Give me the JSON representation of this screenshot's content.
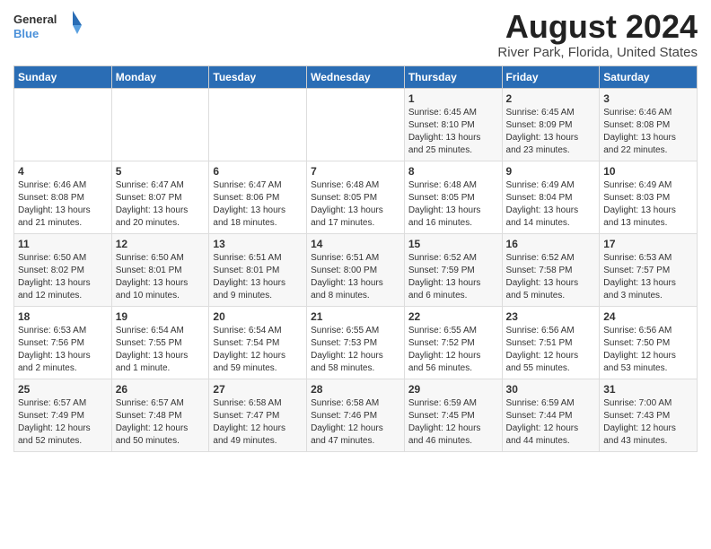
{
  "header": {
    "logo_general": "General",
    "logo_blue": "Blue",
    "title": "August 2024",
    "subtitle": "River Park, Florida, United States"
  },
  "calendar": {
    "days_of_week": [
      "Sunday",
      "Monday",
      "Tuesday",
      "Wednesday",
      "Thursday",
      "Friday",
      "Saturday"
    ],
    "weeks": [
      [
        {
          "day": "",
          "content": ""
        },
        {
          "day": "",
          "content": ""
        },
        {
          "day": "",
          "content": ""
        },
        {
          "day": "",
          "content": ""
        },
        {
          "day": "1",
          "content": "Sunrise: 6:45 AM\nSunset: 8:10 PM\nDaylight: 13 hours\nand 25 minutes."
        },
        {
          "day": "2",
          "content": "Sunrise: 6:45 AM\nSunset: 8:09 PM\nDaylight: 13 hours\nand 23 minutes."
        },
        {
          "day": "3",
          "content": "Sunrise: 6:46 AM\nSunset: 8:08 PM\nDaylight: 13 hours\nand 22 minutes."
        }
      ],
      [
        {
          "day": "4",
          "content": "Sunrise: 6:46 AM\nSunset: 8:08 PM\nDaylight: 13 hours\nand 21 minutes."
        },
        {
          "day": "5",
          "content": "Sunrise: 6:47 AM\nSunset: 8:07 PM\nDaylight: 13 hours\nand 20 minutes."
        },
        {
          "day": "6",
          "content": "Sunrise: 6:47 AM\nSunset: 8:06 PM\nDaylight: 13 hours\nand 18 minutes."
        },
        {
          "day": "7",
          "content": "Sunrise: 6:48 AM\nSunset: 8:05 PM\nDaylight: 13 hours\nand 17 minutes."
        },
        {
          "day": "8",
          "content": "Sunrise: 6:48 AM\nSunset: 8:05 PM\nDaylight: 13 hours\nand 16 minutes."
        },
        {
          "day": "9",
          "content": "Sunrise: 6:49 AM\nSunset: 8:04 PM\nDaylight: 13 hours\nand 14 minutes."
        },
        {
          "day": "10",
          "content": "Sunrise: 6:49 AM\nSunset: 8:03 PM\nDaylight: 13 hours\nand 13 minutes."
        }
      ],
      [
        {
          "day": "11",
          "content": "Sunrise: 6:50 AM\nSunset: 8:02 PM\nDaylight: 13 hours\nand 12 minutes."
        },
        {
          "day": "12",
          "content": "Sunrise: 6:50 AM\nSunset: 8:01 PM\nDaylight: 13 hours\nand 10 minutes."
        },
        {
          "day": "13",
          "content": "Sunrise: 6:51 AM\nSunset: 8:01 PM\nDaylight: 13 hours\nand 9 minutes."
        },
        {
          "day": "14",
          "content": "Sunrise: 6:51 AM\nSunset: 8:00 PM\nDaylight: 13 hours\nand 8 minutes."
        },
        {
          "day": "15",
          "content": "Sunrise: 6:52 AM\nSunset: 7:59 PM\nDaylight: 13 hours\nand 6 minutes."
        },
        {
          "day": "16",
          "content": "Sunrise: 6:52 AM\nSunset: 7:58 PM\nDaylight: 13 hours\nand 5 minutes."
        },
        {
          "day": "17",
          "content": "Sunrise: 6:53 AM\nSunset: 7:57 PM\nDaylight: 13 hours\nand 3 minutes."
        }
      ],
      [
        {
          "day": "18",
          "content": "Sunrise: 6:53 AM\nSunset: 7:56 PM\nDaylight: 13 hours\nand 2 minutes."
        },
        {
          "day": "19",
          "content": "Sunrise: 6:54 AM\nSunset: 7:55 PM\nDaylight: 13 hours\nand 1 minute."
        },
        {
          "day": "20",
          "content": "Sunrise: 6:54 AM\nSunset: 7:54 PM\nDaylight: 12 hours\nand 59 minutes."
        },
        {
          "day": "21",
          "content": "Sunrise: 6:55 AM\nSunset: 7:53 PM\nDaylight: 12 hours\nand 58 minutes."
        },
        {
          "day": "22",
          "content": "Sunrise: 6:55 AM\nSunset: 7:52 PM\nDaylight: 12 hours\nand 56 minutes."
        },
        {
          "day": "23",
          "content": "Sunrise: 6:56 AM\nSunset: 7:51 PM\nDaylight: 12 hours\nand 55 minutes."
        },
        {
          "day": "24",
          "content": "Sunrise: 6:56 AM\nSunset: 7:50 PM\nDaylight: 12 hours\nand 53 minutes."
        }
      ],
      [
        {
          "day": "25",
          "content": "Sunrise: 6:57 AM\nSunset: 7:49 PM\nDaylight: 12 hours\nand 52 minutes."
        },
        {
          "day": "26",
          "content": "Sunrise: 6:57 AM\nSunset: 7:48 PM\nDaylight: 12 hours\nand 50 minutes."
        },
        {
          "day": "27",
          "content": "Sunrise: 6:58 AM\nSunset: 7:47 PM\nDaylight: 12 hours\nand 49 minutes."
        },
        {
          "day": "28",
          "content": "Sunrise: 6:58 AM\nSunset: 7:46 PM\nDaylight: 12 hours\nand 47 minutes."
        },
        {
          "day": "29",
          "content": "Sunrise: 6:59 AM\nSunset: 7:45 PM\nDaylight: 12 hours\nand 46 minutes."
        },
        {
          "day": "30",
          "content": "Sunrise: 6:59 AM\nSunset: 7:44 PM\nDaylight: 12 hours\nand 44 minutes."
        },
        {
          "day": "31",
          "content": "Sunrise: 7:00 AM\nSunset: 7:43 PM\nDaylight: 12 hours\nand 43 minutes."
        }
      ]
    ]
  }
}
